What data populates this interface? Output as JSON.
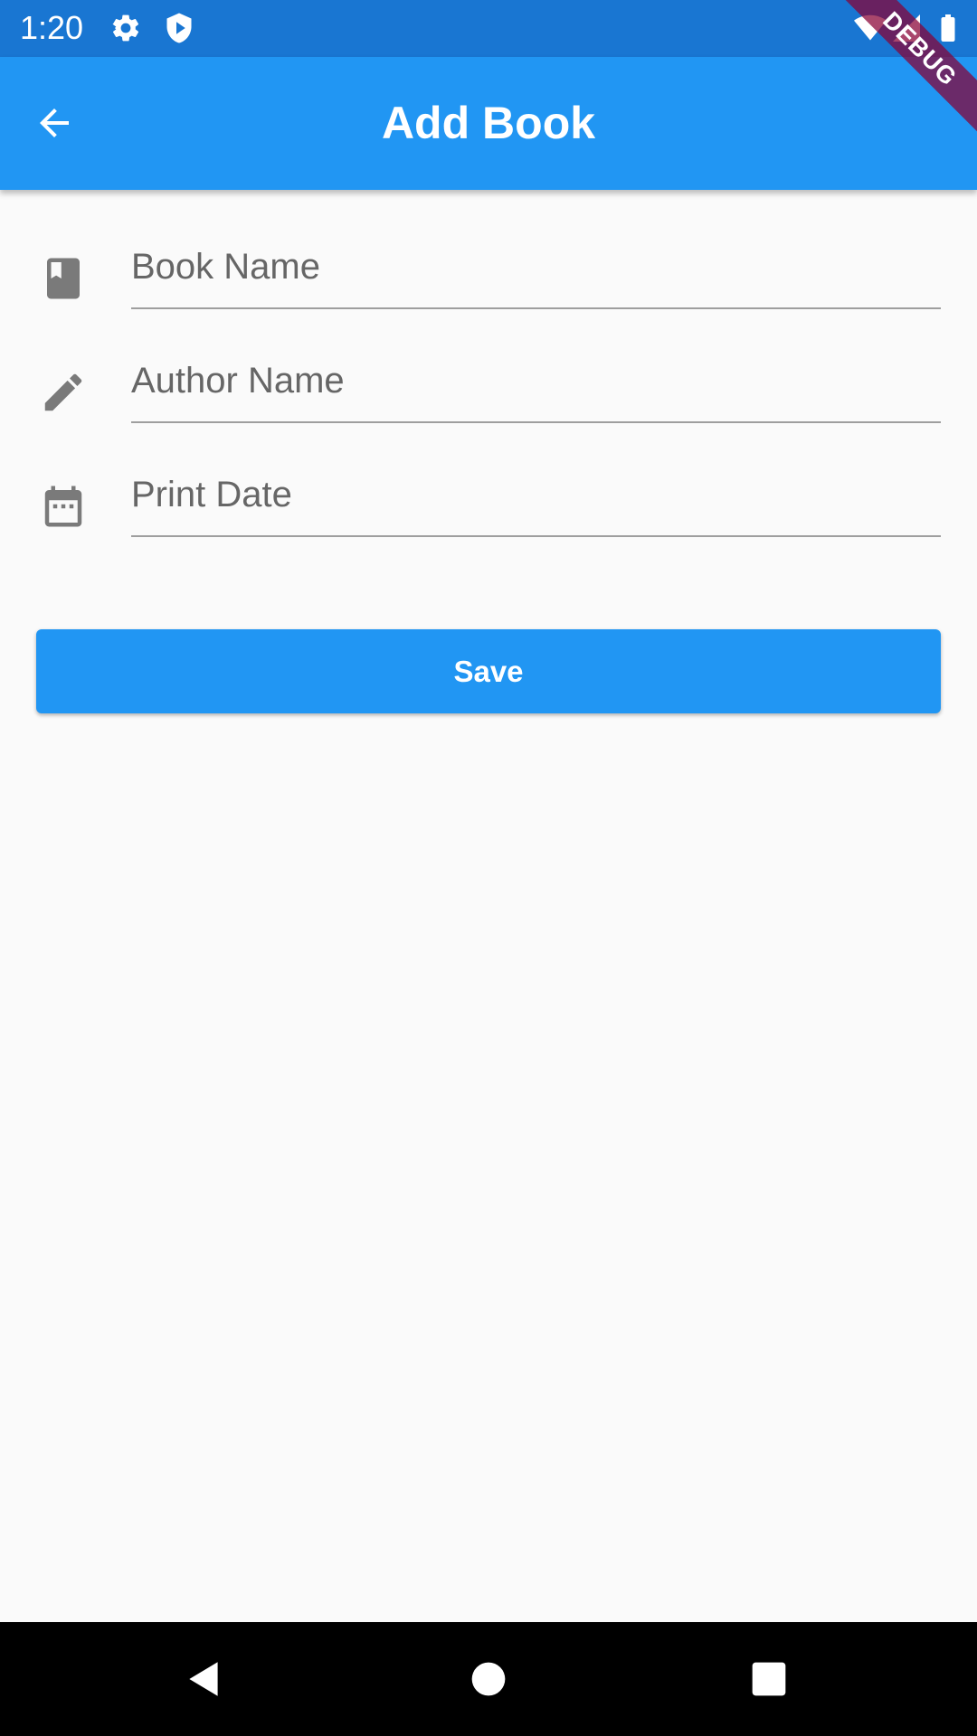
{
  "status_bar": {
    "time": "1:20",
    "left_icons": [
      "gear-icon",
      "shield-play-icon"
    ],
    "right_icons": [
      "wifi-icon",
      "signal-icon",
      "battery-icon"
    ]
  },
  "debug_banner": {
    "label": "DEBUG"
  },
  "app_bar": {
    "title": "Add Book",
    "back_icon": "arrow-back-icon"
  },
  "form": {
    "fields": [
      {
        "icon": "book-icon",
        "placeholder": "Book Name",
        "value": ""
      },
      {
        "icon": "pencil-icon",
        "placeholder": "Author Name",
        "value": ""
      },
      {
        "icon": "calendar-icon",
        "placeholder": "Print Date",
        "value": ""
      }
    ],
    "save_label": "Save"
  },
  "navigation_bar": {
    "icons": [
      "back-triangle-icon",
      "home-circle-icon",
      "recents-square-icon"
    ]
  },
  "colors": {
    "status_bar": "#1976d2",
    "app_bar": "#2196f3",
    "primary": "#2196f3",
    "background": "#fafafa",
    "field_icon": "#7a7a7a",
    "underline": "#9e9e9e",
    "debug_ribbon": "#880033"
  }
}
